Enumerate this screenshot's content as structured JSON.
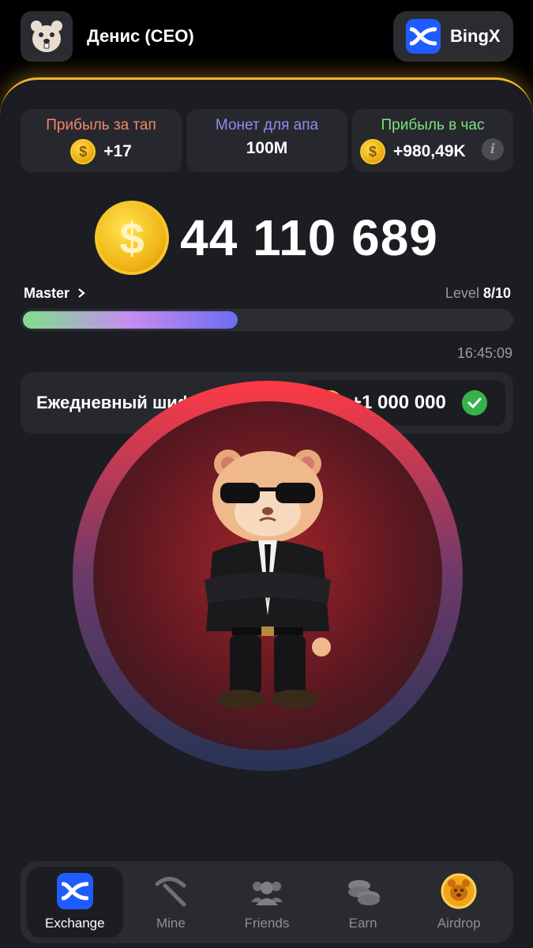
{
  "header": {
    "username": "Денис (CEO)",
    "exchange_name": "BingX"
  },
  "stats": [
    {
      "label": "Прибыль за тап",
      "value": "+17",
      "color": "#f0886a"
    },
    {
      "label": "Монет для апа",
      "value": "100M",
      "color": "#8f8cf3"
    },
    {
      "label": "Прибыль в час",
      "value": "+980,49K",
      "color": "#7fe07f"
    }
  ],
  "balance": "44 110 689",
  "rank": "Master",
  "level": {
    "prefix": "Level",
    "value": "8/10",
    "progress": 0.44
  },
  "timer": "16:45:09",
  "daily_cipher": {
    "title": "Ежедневный шифр",
    "reward": "+1 000 000"
  },
  "nav": [
    {
      "label": "Exchange",
      "icon": "bingx-icon",
      "active": true
    },
    {
      "label": "Mine",
      "icon": "pickaxe-icon",
      "active": false
    },
    {
      "label": "Friends",
      "icon": "friends-icon",
      "active": false
    },
    {
      "label": "Earn",
      "icon": "coins-icon",
      "active": false
    },
    {
      "label": "Airdrop",
      "icon": "airdrop-icon",
      "active": false
    }
  ],
  "colors": {
    "accent": "#f3b431",
    "brand_blue": "#1f5bff",
    "background": "#1c1d22"
  }
}
